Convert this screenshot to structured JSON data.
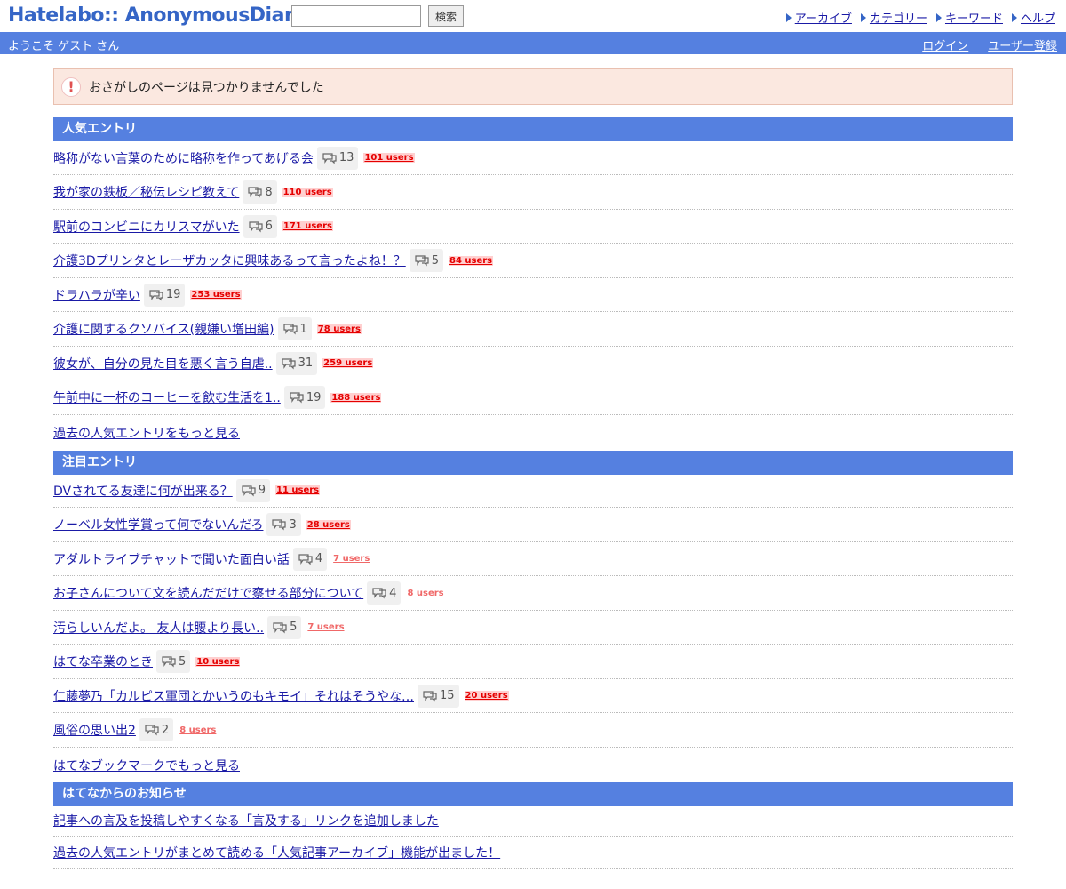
{
  "header": {
    "logo": "Hatelabo:: AnonymousDiary",
    "search_placeholder": "",
    "search_button": "検索",
    "nav": [
      "アーカイブ",
      "カテゴリー",
      "キーワード",
      "ヘルプ"
    ]
  },
  "welcome": {
    "text": "ようこそ ゲスト さん",
    "login": "ログイン",
    "register": "ユーザー登録"
  },
  "notice": {
    "text": "おさがしのページは見つかりませんでした"
  },
  "popular": {
    "title": "人気エントリ",
    "entries": [
      {
        "title": "略称がない言葉のために略称を作ってあげる会",
        "comments": "13",
        "users": "101 users"
      },
      {
        "title": "我が家の鉄板／秘伝レシピ教えて",
        "comments": "8",
        "users": "110 users"
      },
      {
        "title": "駅前のコンビニにカリスマがいた",
        "comments": "6",
        "users": "171 users"
      },
      {
        "title": "介護3Dプリンタとレーザカッタに興味あるって言ったよね！？",
        "comments": "5",
        "users": "84 users"
      },
      {
        "title": "ドラハラが辛い",
        "comments": "19",
        "users": "253 users"
      },
      {
        "title": "介護に関するクソバイス(親嫌い増田編)",
        "comments": "1",
        "users": "78 users"
      },
      {
        "title": "彼女が、自分の見た目を悪く言う自虐..",
        "comments": "31",
        "users": "259 users"
      },
      {
        "title": "午前中に一杯のコーヒーを飲む生活を1..",
        "comments": "19",
        "users": "188 users"
      }
    ],
    "more": "過去の人気エントリをもっと見る"
  },
  "attention": {
    "title": "注目エントリ",
    "entries": [
      {
        "title": "DVされてる友達に何が出来る？",
        "comments": "9",
        "users": "11 users",
        "level": "hot"
      },
      {
        "title": "ノーベル女性学賞って何でないんだろ",
        "comments": "3",
        "users": "28 users",
        "level": "hot"
      },
      {
        "title": "アダルトライブチャットで聞いた面白い話",
        "comments": "4",
        "users": "7 users",
        "level": "warm"
      },
      {
        "title": "お子さんについて文を読んだだけで察せる部分について",
        "comments": "4",
        "users": "8 users",
        "level": "warm"
      },
      {
        "title": "汚らしいんだよ。 友人は腰より長い..",
        "comments": "5",
        "users": "7 users",
        "level": "warm"
      },
      {
        "title": "はてな卒業のとき",
        "comments": "5",
        "users": "10 users",
        "level": "hot"
      },
      {
        "title": "仁藤夢乃「カルピス軍団とかいうのもキモイ」それはそうやな…",
        "comments": "15",
        "users": "20 users",
        "level": "hot"
      },
      {
        "title": "風俗の思い出2",
        "comments": "2",
        "users": "8 users",
        "level": "warm"
      }
    ],
    "more": "はてなブックマークでもっと見る"
  },
  "news": {
    "title": "はてなからのお知らせ",
    "items": [
      "記事への言及を投稿しやすくなる「言及する」リンクを追加しました",
      "過去の人気エントリがまとめて読める「人気記事アーカイブ」機能が出ました！"
    ]
  },
  "colors": {
    "accent": "#5580e0",
    "logo": "#3565c6",
    "link": "#1a1aa6",
    "users_hot": "#e50000",
    "users_warm": "#f06868"
  }
}
